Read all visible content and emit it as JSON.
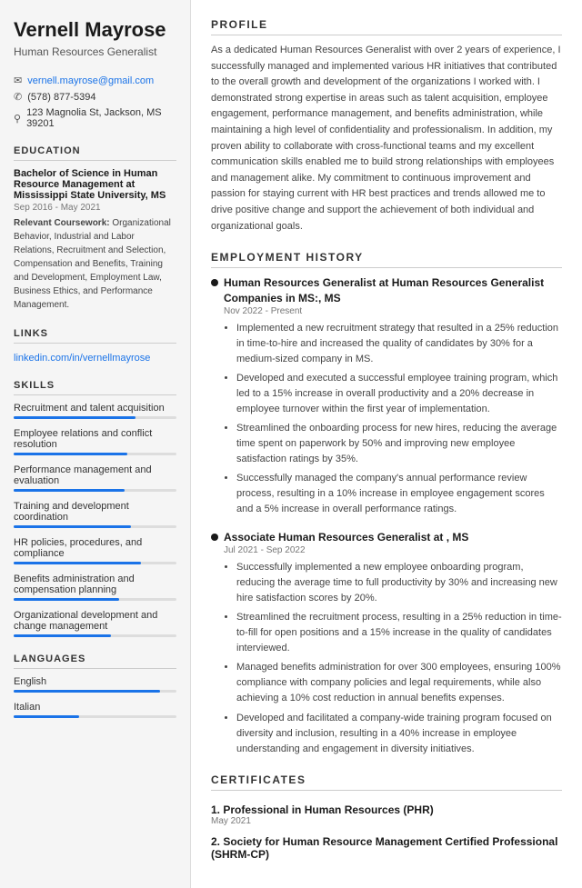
{
  "sidebar": {
    "name": "Vernell Mayrose",
    "title": "Human Resources Generalist",
    "contact": {
      "email": "vernell.mayrose@gmail.com",
      "phone": "(578) 877-5394",
      "address": "123 Magnolia St, Jackson, MS 39201"
    },
    "education": {
      "heading": "EDUCATION",
      "degree": "Bachelor of Science in Human Resource Management at Mississippi State University, MS",
      "dates": "Sep 2016 - May 2021",
      "coursework_label": "Relevant Coursework:",
      "coursework": "Organizational Behavior, Industrial and Labor Relations, Recruitment and Selection, Compensation and Benefits, Training and Development, Employment Law, Business Ethics, and Performance Management."
    },
    "links": {
      "heading": "LINKS",
      "url_label": "linkedin.com/in/vernellmayrose",
      "url": "https://linkedin.com/in/vernellmayrose"
    },
    "skills": {
      "heading": "SKILLS",
      "items": [
        {
          "label": "Recruitment and talent acquisition",
          "pct": 75
        },
        {
          "label": "Employee relations and conflict resolution",
          "pct": 70
        },
        {
          "label": "Performance management and evaluation",
          "pct": 68
        },
        {
          "label": "Training and development coordination",
          "pct": 72
        },
        {
          "label": "HR policies, procedures, and compliance",
          "pct": 78
        },
        {
          "label": "Benefits administration and compensation planning",
          "pct": 65
        },
        {
          "label": "Organizational development and change management",
          "pct": 60
        }
      ]
    },
    "languages": {
      "heading": "LANGUAGES",
      "items": [
        {
          "label": "English",
          "pct": 90
        },
        {
          "label": "Italian",
          "pct": 40
        }
      ]
    }
  },
  "main": {
    "profile": {
      "heading": "PROFILE",
      "text": "As a dedicated Human Resources Generalist with over 2 years of experience, I successfully managed and implemented various HR initiatives that contributed to the overall growth and development of the organizations I worked with. I demonstrated strong expertise in areas such as talent acquisition, employee engagement, performance management, and benefits administration, while maintaining a high level of confidentiality and professionalism. In addition, my proven ability to collaborate with cross-functional teams and my excellent communication skills enabled me to build strong relationships with employees and management alike. My commitment to continuous improvement and passion for staying current with HR best practices and trends allowed me to drive positive change and support the achievement of both individual and organizational goals."
    },
    "employment": {
      "heading": "EMPLOYMENT HISTORY",
      "jobs": [
        {
          "title": "Human Resources Generalist at Human Resources Generalist Companies in MS:, MS",
          "dates": "Nov 2022 - Present",
          "bullets": [
            "Implemented a new recruitment strategy that resulted in a 25% reduction in time-to-hire and increased the quality of candidates by 30% for a medium-sized company in MS.",
            "Developed and executed a successful employee training program, which led to a 15% increase in overall productivity and a 20% decrease in employee turnover within the first year of implementation.",
            "Streamlined the onboarding process for new hires, reducing the average time spent on paperwork by 50% and improving new employee satisfaction ratings by 35%.",
            "Successfully managed the company's annual performance review process, resulting in a 10% increase in employee engagement scores and a 5% increase in overall performance ratings."
          ]
        },
        {
          "title": "Associate Human Resources Generalist at , MS",
          "dates": "Jul 2021 - Sep 2022",
          "bullets": [
            "Successfully implemented a new employee onboarding program, reducing the average time to full productivity by 30% and increasing new hire satisfaction scores by 20%.",
            "Streamlined the recruitment process, resulting in a 25% reduction in time-to-fill for open positions and a 15% increase in the quality of candidates interviewed.",
            "Managed benefits administration for over 300 employees, ensuring 100% compliance with company policies and legal requirements, while also achieving a 10% cost reduction in annual benefits expenses.",
            "Developed and facilitated a company-wide training program focused on diversity and inclusion, resulting in a 40% increase in employee understanding and engagement in diversity initiatives."
          ]
        }
      ]
    },
    "certificates": {
      "heading": "CERTIFICATES",
      "items": [
        {
          "number": "1.",
          "title": "Professional in Human Resources (PHR)",
          "date": "May 2021"
        },
        {
          "number": "2.",
          "title": "Society for Human Resource Management Certified Professional (SHRM-CP)",
          "date": ""
        }
      ]
    }
  }
}
